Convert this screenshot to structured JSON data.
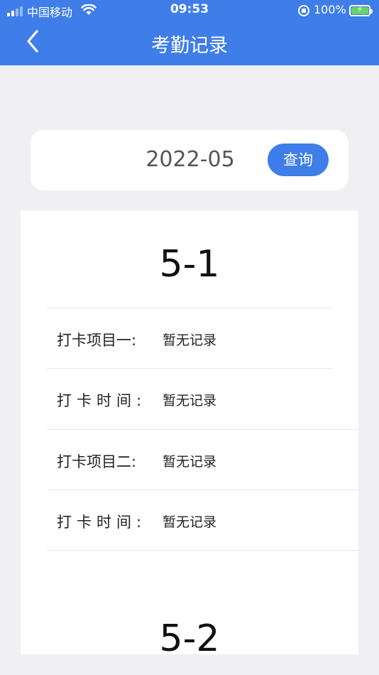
{
  "status_bar": {
    "carrier": "中国移动",
    "time": "09:53",
    "battery": "100%"
  },
  "header": {
    "title": "考勤记录",
    "back_icon": "chevron-left-icon"
  },
  "query": {
    "month": "2022-05",
    "button_label": "查询"
  },
  "days": [
    {
      "date": "5-1",
      "rows": [
        {
          "label": "打卡项目一:",
          "value": "暂无记录"
        },
        {
          "label": "打卡时间:",
          "value": "暂无记录"
        },
        {
          "label": "打卡项目二:",
          "value": "暂无记录"
        },
        {
          "label": "打卡时间:",
          "value": "暂无记录"
        }
      ]
    },
    {
      "date": "5-2"
    }
  ],
  "colors": {
    "brand_blue": "#3f7ee8",
    "page_background": "#efeff4"
  }
}
